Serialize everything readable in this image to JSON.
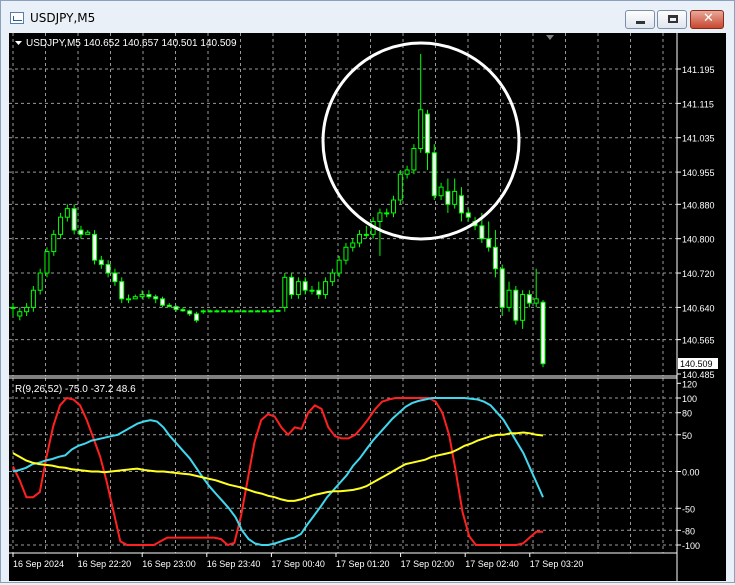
{
  "window": {
    "title": "USDJPY,M5",
    "icon": "chart-window-icon"
  },
  "main_header": "USDJPY,M5  140.652 140.657 140.501 140.509",
  "main_price_axis": [
    "141.195",
    "141.115",
    "141.035",
    "140.955",
    "140.880",
    "140.800",
    "140.720",
    "140.640",
    "140.565",
    "140.485"
  ],
  "current_price": "140.509",
  "indicator_header": "R(9,26,52) -75.0 -37.2 48.6",
  "indicator_axis": [
    "120",
    "100",
    "80",
    "50",
    "0.00",
    "-50",
    "-80",
    "-100"
  ],
  "time_axis": [
    "16 Sep 2024",
    "16 Sep 22:20",
    "16 Sep 23:00",
    "16 Sep 23:40",
    "17 Sep 00:40",
    "17 Sep 01:20",
    "17 Sep 02:00",
    "17 Sep 02:40",
    "17 Sep 03:20"
  ],
  "colors": {
    "bull": "#00ff00",
    "bear": "#ffffff",
    "fast": "#ff2020",
    "mid": "#40d8f0",
    "slow": "#ffff20"
  },
  "chart_data": [
    {
      "type": "candlestick",
      "title": "USDJPY,M5",
      "ylim": [
        140.485,
        141.195
      ],
      "ohlc": [
        [
          140.64,
          140.65,
          140.62,
          140.64
        ],
        [
          140.62,
          140.64,
          140.61,
          140.63
        ],
        [
          140.63,
          140.65,
          140.62,
          140.64
        ],
        [
          140.64,
          140.69,
          140.63,
          140.68
        ],
        [
          140.68,
          140.73,
          140.67,
          140.72
        ],
        [
          140.72,
          140.78,
          140.71,
          140.77
        ],
        [
          140.77,
          140.82,
          140.76,
          140.81
        ],
        [
          140.81,
          140.86,
          140.8,
          140.85
        ],
        [
          140.85,
          140.88,
          140.84,
          140.87
        ],
        [
          140.87,
          140.88,
          140.81,
          140.82
        ],
        [
          140.82,
          140.83,
          140.8,
          140.81
        ],
        [
          140.81,
          140.82,
          140.81,
          140.815
        ],
        [
          140.81,
          140.82,
          140.74,
          140.75
        ],
        [
          140.75,
          140.76,
          140.73,
          140.74
        ],
        [
          140.74,
          140.75,
          140.71,
          140.72
        ],
        [
          140.72,
          140.73,
          140.69,
          140.7
        ],
        [
          140.7,
          140.71,
          140.65,
          140.66
        ],
        [
          140.66,
          140.67,
          140.65,
          140.66
        ],
        [
          140.66,
          140.67,
          140.66,
          140.665
        ],
        [
          140.665,
          140.68,
          140.66,
          140.67
        ],
        [
          140.67,
          140.68,
          140.66,
          140.665
        ],
        [
          140.665,
          140.67,
          140.65,
          140.66
        ],
        [
          140.66,
          140.665,
          140.64,
          140.645
        ],
        [
          140.645,
          140.65,
          140.64,
          140.642
        ],
        [
          140.642,
          140.645,
          140.63,
          140.635
        ],
        [
          140.635,
          140.64,
          140.63,
          140.632
        ],
        [
          140.632,
          140.635,
          140.62,
          140.625
        ],
        [
          140.625,
          140.63,
          140.605,
          140.61
        ],
        [
          140.63,
          140.635,
          140.625,
          140.632
        ],
        [
          140.632,
          140.635,
          140.628,
          140.632
        ],
        [
          140.632,
          140.635,
          140.628,
          140.632
        ],
        [
          140.632,
          140.634,
          140.63,
          140.632
        ],
        [
          140.632,
          140.634,
          140.63,
          140.632
        ],
        [
          140.632,
          140.634,
          140.63,
          140.632
        ],
        [
          140.632,
          140.634,
          140.63,
          140.632
        ],
        [
          140.632,
          140.634,
          140.63,
          140.632
        ],
        [
          140.632,
          140.634,
          140.63,
          140.632
        ],
        [
          140.632,
          140.634,
          140.63,
          140.632
        ],
        [
          140.632,
          140.634,
          140.63,
          140.632
        ],
        [
          140.632,
          140.635,
          140.63,
          140.633
        ],
        [
          140.64,
          140.72,
          140.63,
          140.71
        ],
        [
          140.71,
          140.72,
          140.66,
          140.67
        ],
        [
          140.67,
          140.71,
          140.66,
          140.7
        ],
        [
          140.7,
          140.71,
          140.67,
          140.68
        ],
        [
          140.68,
          140.69,
          140.67,
          140.68
        ],
        [
          140.68,
          140.7,
          140.66,
          140.67
        ],
        [
          140.67,
          140.71,
          140.66,
          140.7
        ],
        [
          140.7,
          140.73,
          140.69,
          140.72
        ],
        [
          140.72,
          140.76,
          140.71,
          140.75
        ],
        [
          140.75,
          140.79,
          140.74,
          140.78
        ],
        [
          140.78,
          140.8,
          140.77,
          140.79
        ],
        [
          140.79,
          140.82,
          140.78,
          140.81
        ],
        [
          140.81,
          140.83,
          140.8,
          140.81
        ],
        [
          140.81,
          140.85,
          140.8,
          140.84
        ],
        [
          140.84,
          140.87,
          140.76,
          140.86
        ],
        [
          140.86,
          140.87,
          140.85,
          140.86
        ],
        [
          140.86,
          140.9,
          140.85,
          140.89
        ],
        [
          140.89,
          140.96,
          140.88,
          140.95
        ],
        [
          140.95,
          140.97,
          140.94,
          140.96
        ],
        [
          140.96,
          141.02,
          140.95,
          141.01
        ],
        [
          141.01,
          141.23,
          141.0,
          141.1
        ],
        [
          141.09,
          141.1,
          140.96,
          141.0
        ],
        [
          141.0,
          141.02,
          140.89,
          140.9
        ],
        [
          140.9,
          140.93,
          140.89,
          140.92
        ],
        [
          140.91,
          140.94,
          140.86,
          140.88
        ],
        [
          140.88,
          140.94,
          140.87,
          140.91
        ],
        [
          140.9,
          140.92,
          140.84,
          140.86
        ],
        [
          140.86,
          140.87,
          140.84,
          140.85
        ],
        [
          140.84,
          140.85,
          140.82,
          140.83
        ],
        [
          140.83,
          140.86,
          140.79,
          140.8
        ],
        [
          140.8,
          140.84,
          140.77,
          140.78
        ],
        [
          140.78,
          140.82,
          140.71,
          140.73
        ],
        [
          140.73,
          140.74,
          140.62,
          140.64
        ],
        [
          140.64,
          140.7,
          140.63,
          140.68
        ],
        [
          140.68,
          140.69,
          140.6,
          140.61
        ],
        [
          140.61,
          140.68,
          140.59,
          140.67
        ],
        [
          140.67,
          140.68,
          140.64,
          140.65
        ],
        [
          140.65,
          140.73,
          140.64,
          140.66
        ],
        [
          140.652,
          140.657,
          140.501,
          140.509
        ]
      ]
    },
    {
      "type": "line",
      "title": "R(9,26,52)",
      "ylim": [
        -108,
        120
      ],
      "series": [
        {
          "name": "R(9)",
          "values": [
            7,
            -12,
            -35,
            -35,
            -28,
            20,
            62,
            90,
            100,
            98,
            90,
            70,
            45,
            20,
            -15,
            -55,
            -95,
            -100,
            -100,
            -100,
            -100,
            -100,
            -95,
            -90,
            -90,
            -90,
            -90,
            -90,
            -90,
            -90,
            -90,
            -92,
            -100,
            -97,
            -60,
            -10,
            40,
            70,
            78,
            75,
            60,
            50,
            60,
            58,
            80,
            90,
            85,
            60,
            48,
            45,
            45,
            50,
            60,
            72,
            85,
            95,
            98,
            100,
            100,
            100,
            100,
            100,
            100,
            95,
            80,
            50,
            0,
            -55,
            -88,
            -100,
            -100,
            -100,
            -100,
            -100,
            -100,
            -100,
            -98,
            -90,
            -82,
            -82
          ]
        },
        {
          "name": "R(26)",
          "values": [
            0,
            2,
            5,
            10,
            12,
            15,
            17,
            20,
            22,
            30,
            35,
            38,
            42,
            44,
            46,
            48,
            50,
            55,
            60,
            65,
            68,
            70,
            68,
            60,
            48,
            38,
            28,
            18,
            5,
            -8,
            -20,
            -30,
            -40,
            -50,
            -62,
            -80,
            -92,
            -98,
            -100,
            -100,
            -98,
            -95,
            -92,
            -90,
            -85,
            -72,
            -60,
            -48,
            -35,
            -25,
            -15,
            -5,
            8,
            18,
            30,
            42,
            52,
            62,
            72,
            80,
            88,
            93,
            96,
            98,
            100,
            100,
            100,
            100,
            100,
            100,
            99,
            98,
            95,
            90,
            80,
            70,
            55,
            40,
            25,
            5,
            -15,
            -35
          ]
        },
        {
          "name": "R(52)",
          "values": [
            25,
            20,
            15,
            12,
            10,
            9,
            8,
            6,
            5,
            3,
            2,
            1,
            0,
            0,
            -1,
            0,
            1,
            2,
            3,
            4,
            2,
            1,
            0,
            0,
            -1,
            -2,
            -3,
            -4,
            -6,
            -8,
            -10,
            -12,
            -15,
            -18,
            -20,
            -22,
            -25,
            -28,
            -30,
            -33,
            -35,
            -38,
            -40,
            -40,
            -38,
            -35,
            -32,
            -30,
            -28,
            -27,
            -27,
            -26,
            -25,
            -23,
            -20,
            -15,
            -10,
            -5,
            0,
            5,
            10,
            12,
            14,
            16,
            20,
            22,
            24,
            26,
            30,
            35,
            38,
            42,
            45,
            48,
            50,
            50,
            52,
            52,
            53,
            52,
            50,
            49
          ]
        }
      ]
    }
  ]
}
